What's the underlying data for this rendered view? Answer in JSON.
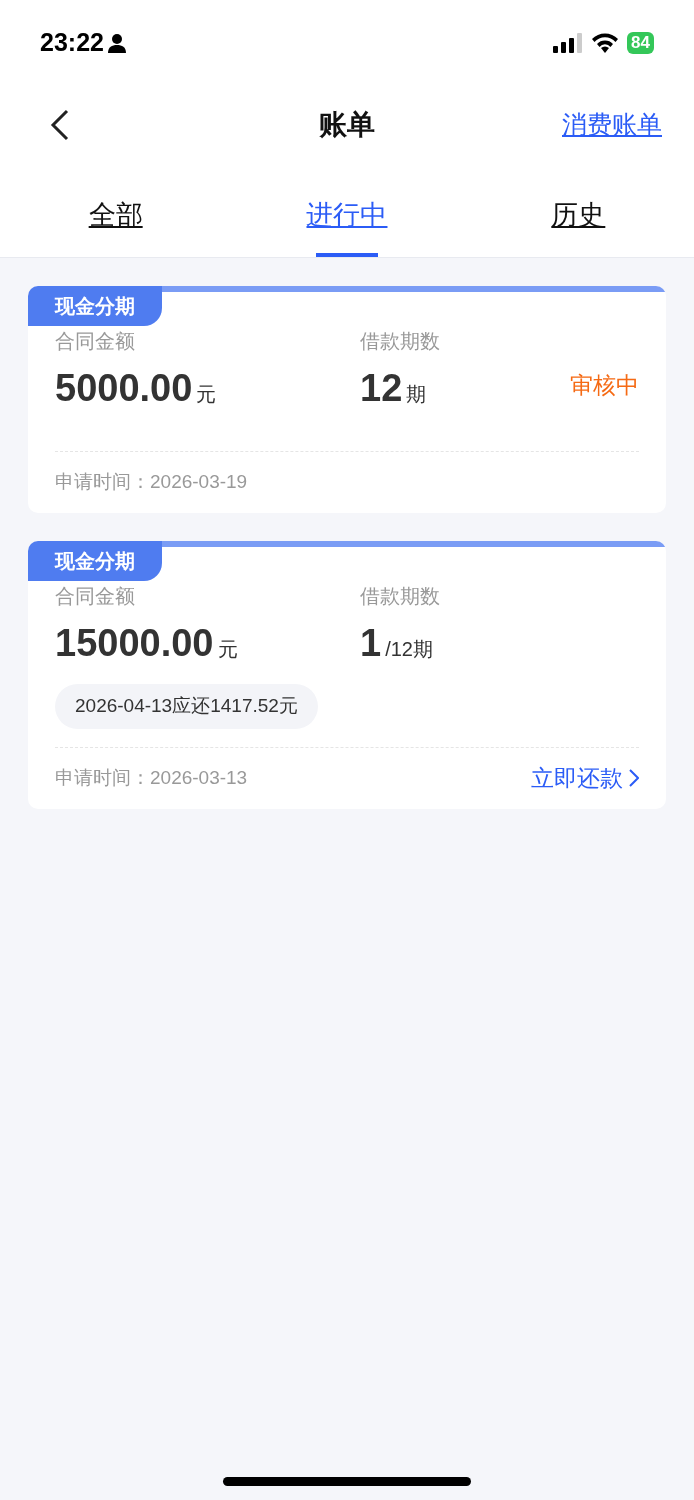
{
  "status_bar": {
    "time": "23:22",
    "battery": "84"
  },
  "header": {
    "title": "账单",
    "right_link": "消费账单"
  },
  "tabs": [
    {
      "label": "全部",
      "selected": false
    },
    {
      "label": "进行中",
      "selected": true
    },
    {
      "label": "历史",
      "selected": false
    }
  ],
  "cards": [
    {
      "tag": "现金分期",
      "amount_label": "合同金额",
      "amount": "5000.00",
      "amount_unit": "元",
      "term_label": "借款期数",
      "term": "12",
      "term_unit": "期",
      "status": "审核中",
      "apply_time": "申请时间：2026-03-19"
    },
    {
      "tag": "现金分期",
      "amount_label": "合同金额",
      "amount": "15000.00",
      "amount_unit": "元",
      "term_label": "借款期数",
      "term": "1",
      "term_unit": "/12期",
      "due_note": "2026-04-13应还1417.52元",
      "apply_time": "申请时间：2026-03-13",
      "action": "立即还款"
    }
  ]
}
